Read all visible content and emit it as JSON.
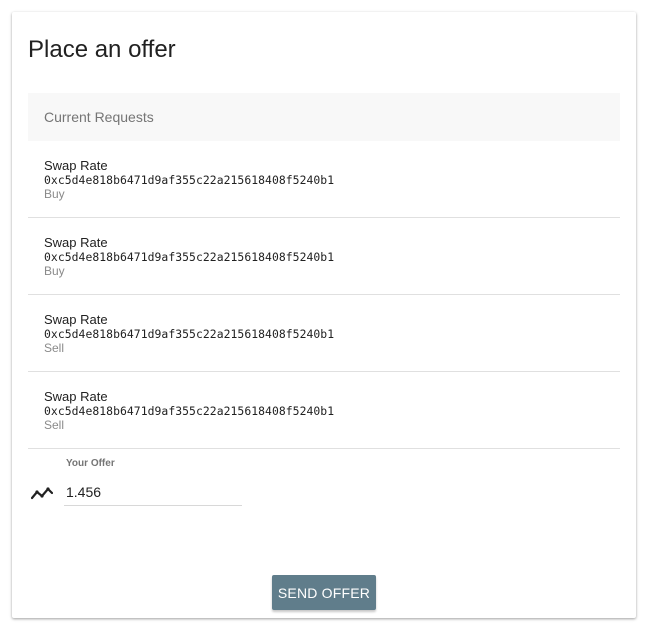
{
  "page": {
    "title": "Place an offer"
  },
  "requests": {
    "subheader": "Current Requests",
    "items": [
      {
        "title": "Swap Rate",
        "address": "0xc5d4e818b6471d9af355c22a215618408f5240b1",
        "side": "Buy"
      },
      {
        "title": "Swap Rate",
        "address": "0xc5d4e818b6471d9af355c22a215618408f5240b1",
        "side": "Buy"
      },
      {
        "title": "Swap Rate",
        "address": "0xc5d4e818b6471d9af355c22a215618408f5240b1",
        "side": "Sell"
      },
      {
        "title": "Swap Rate",
        "address": "0xc5d4e818b6471d9af355c22a215618408f5240b1",
        "side": "Sell"
      }
    ]
  },
  "offer": {
    "label": "Your Offer",
    "value": "1.456",
    "icon": "trending-icon"
  },
  "actions": {
    "send_label": "SEND OFFER",
    "send_color": "#607d8b"
  }
}
